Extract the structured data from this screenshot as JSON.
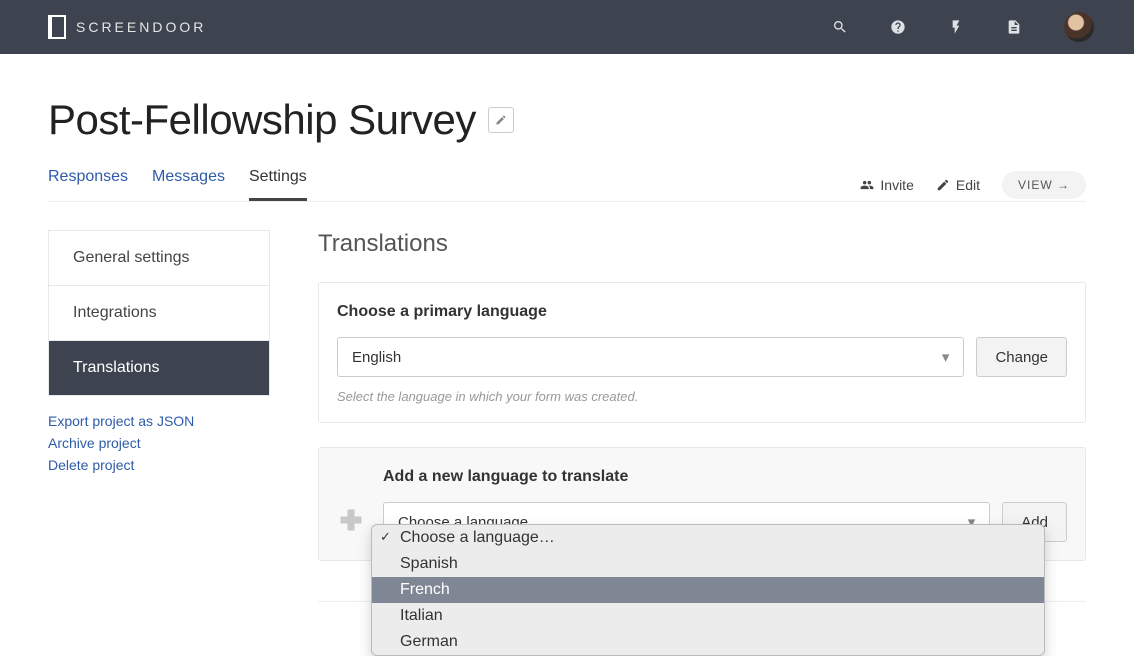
{
  "brand": "SCREENDOOR",
  "page_title": "Post-Fellowship Survey",
  "tabs": {
    "responses": "Responses",
    "messages": "Messages",
    "settings": "Settings"
  },
  "actions": {
    "invite": "Invite",
    "edit": "Edit",
    "view": "VIEW →"
  },
  "sidebar": {
    "general": "General settings",
    "integrations": "Integrations",
    "translations": "Translations",
    "export_json": "Export project as JSON",
    "archive": "Archive project",
    "delete": "Delete project"
  },
  "section_title": "Translations",
  "primary": {
    "label": "Choose a primary language",
    "value": "English",
    "button": "Change",
    "helper": "Select the language in which your form was created."
  },
  "add": {
    "label": "Add a new language to translate",
    "button": "Add",
    "options": {
      "placeholder": "Choose a language…",
      "spanish": "Spanish",
      "french": "French",
      "italian": "Italian",
      "german": "German"
    }
  }
}
